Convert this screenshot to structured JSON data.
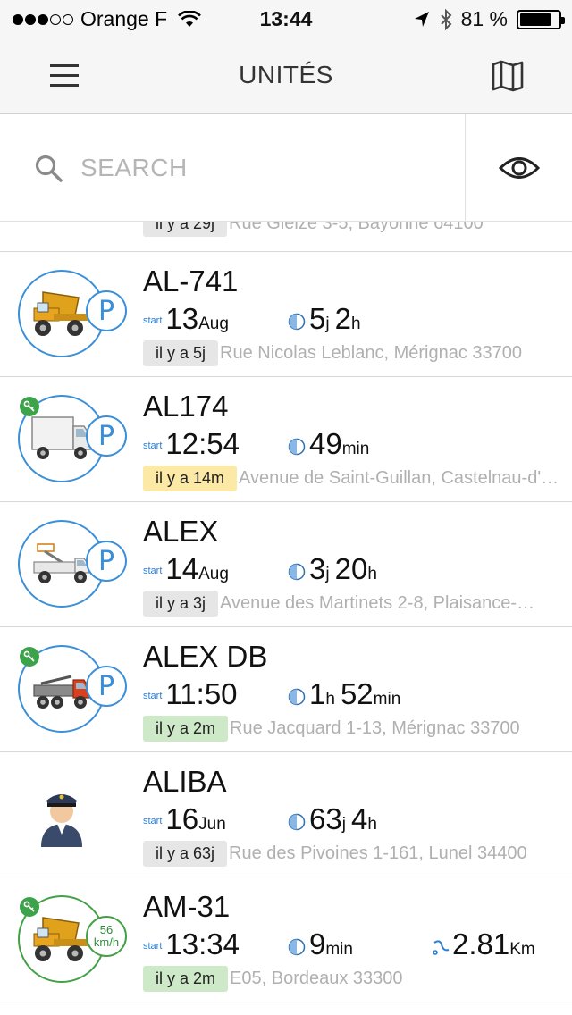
{
  "status_bar": {
    "carrier": "Orange F",
    "time": "13:44",
    "battery": "81 %",
    "battery_level": 0.81
  },
  "nav": {
    "title": "UNITÉS",
    "menu_icon": "hamburger-menu-icon",
    "map_icon": "map-icon"
  },
  "search": {
    "placeholder": "SEARCH",
    "value": "",
    "visibility_icon": "eye-icon"
  },
  "partial_row": {
    "age": "il y a 29j",
    "address": "Rue Gleize 3-5, Bayonne 64100"
  },
  "units": [
    {
      "name": "AL-741",
      "vehicle_icon": "dump-truck-icon",
      "status_badge": "P",
      "connected": false,
      "start_label": "start",
      "start_big": "13",
      "start_small": "Aug",
      "duration": [
        [
          "5",
          "j"
        ],
        [
          "2",
          "h"
        ]
      ],
      "age": "il y a 5j",
      "age_color": "gray",
      "address": "Rue Nicolas Leblanc, Mérignac 33700"
    },
    {
      "name": "AL174",
      "vehicle_icon": "box-truck-icon",
      "status_badge": "P",
      "connected": true,
      "start_label": "start",
      "start_big": "12:54",
      "start_small": "",
      "duration": [
        [
          "49",
          "min"
        ]
      ],
      "age": "il y a 14m",
      "age_color": "yellow",
      "address": "Avenue de Saint-Guillan, Castelnau-d'…"
    },
    {
      "name": "ALEX",
      "vehicle_icon": "aerial-lift-truck-icon",
      "status_badge": "P",
      "connected": false,
      "start_label": "start",
      "start_big": "14",
      "start_small": "Aug",
      "duration": [
        [
          "3",
          "j"
        ],
        [
          "20",
          "h"
        ]
      ],
      "age": "il y a 3j",
      "age_color": "gray",
      "address": "Avenue des Martinets 2-8, Plaisance-…"
    },
    {
      "name": "ALEX DB",
      "vehicle_icon": "crane-truck-icon",
      "status_badge": "P",
      "connected": true,
      "start_label": "start",
      "start_big": "11:50",
      "start_small": "",
      "duration": [
        [
          "1",
          "h"
        ],
        [
          "52",
          "min"
        ]
      ],
      "age": "il y a 2m",
      "age_color": "green",
      "address": "Rue Jacquard 1-13, Mérignac 33700"
    },
    {
      "name": "ALIBA",
      "vehicle_icon": "driver-avatar-icon",
      "status_badge": "",
      "connected": false,
      "start_label": "start",
      "start_big": "16",
      "start_small": "Jun",
      "duration": [
        [
          "63",
          "j"
        ],
        [
          "4",
          "h"
        ]
      ],
      "age": "il y a 63j",
      "age_color": "gray",
      "address": "Rue des Pivoines 1-161, Lunel 34400"
    },
    {
      "name": "AM-31",
      "vehicle_icon": "dump-truck-icon",
      "status_badge": "",
      "speed_value": "56",
      "speed_unit": "km/h",
      "connected": true,
      "start_label": "start",
      "start_big": "13:34",
      "start_small": "",
      "duration": [
        [
          "9",
          "min"
        ]
      ],
      "distance_value": "2.81",
      "distance_unit": "Km",
      "age": "il y a 2m",
      "age_color": "green",
      "address": "E05, Bordeaux 33300"
    }
  ],
  "colors": {
    "accent_blue": "#3a8fd8",
    "moving_green": "#43a047",
    "age_yellow": "#fde9a6",
    "age_green": "#cde9c7",
    "age_gray": "#e6e6e6"
  }
}
